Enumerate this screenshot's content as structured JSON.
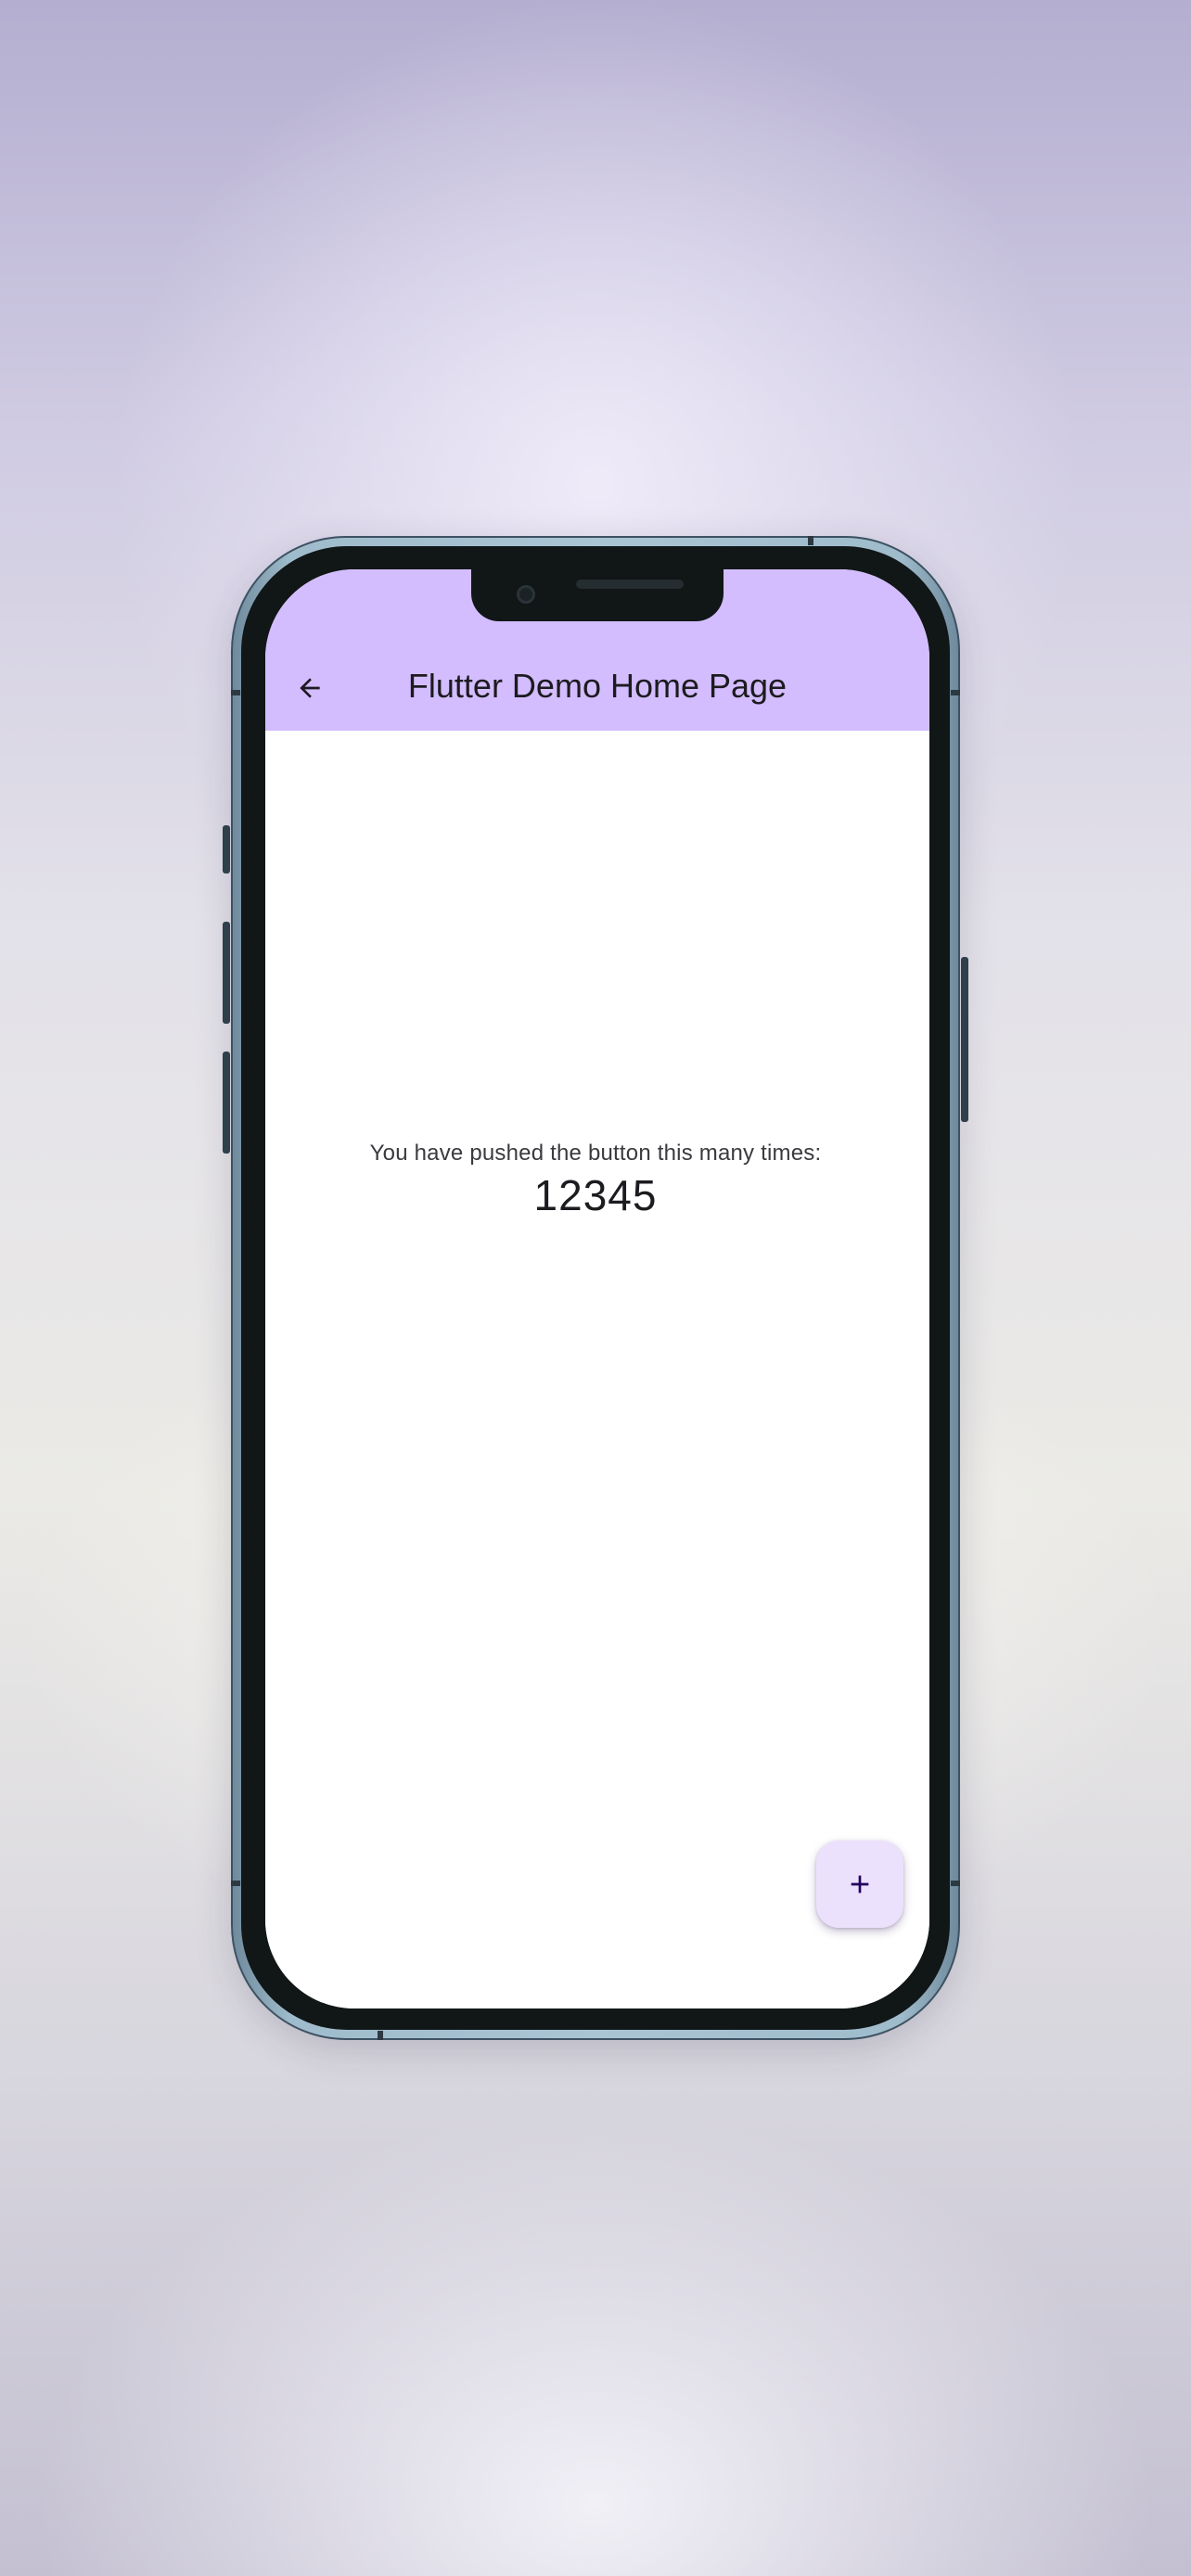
{
  "app_bar": {
    "title": "Flutter Demo Home Page",
    "back_icon": "arrow-back-icon",
    "background_color": "#d3bdfe"
  },
  "main": {
    "message": "You have pushed the button this many times:",
    "counter": "12345"
  },
  "fab": {
    "icon": "plus-icon",
    "background_color": "#ebe1fc"
  }
}
